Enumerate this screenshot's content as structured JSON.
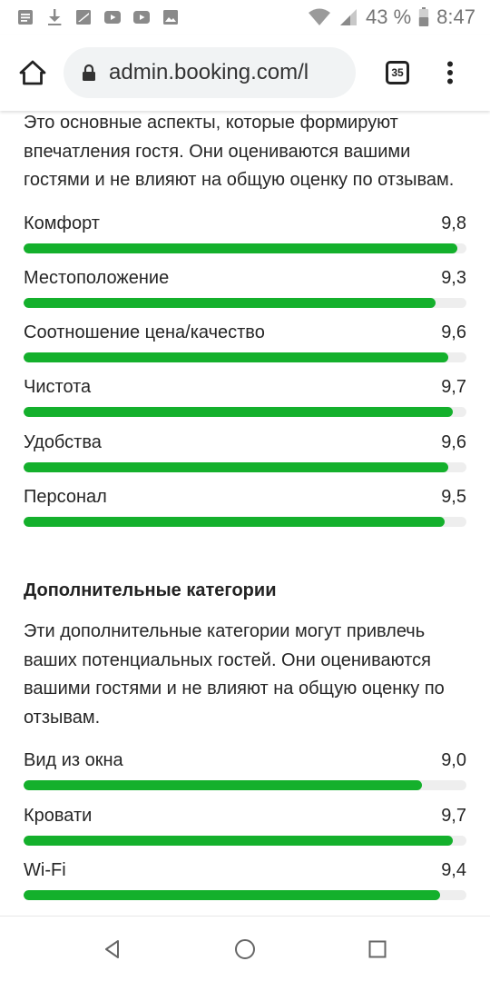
{
  "status_bar": {
    "battery_percent": "43 %",
    "time": "8:47",
    "icons": [
      "notes-icon",
      "download-icon",
      "image-broken-icon",
      "youtube-icon",
      "youtube-icon",
      "gallery-icon",
      "wifi-icon",
      "signal-icon",
      "battery-icon"
    ]
  },
  "browser": {
    "url": "admin.booking.com/l",
    "tabs_count": "35"
  },
  "main": {
    "intro_text": "Это основные аспекты, которые формируют впечатления гостя. Они оцениваются вашими гостями и не влияют на общую оценку по отзывам.",
    "ratings": [
      {
        "label": "Комфорт",
        "score_text": "9,8",
        "score": 9.8
      },
      {
        "label": "Местоположение",
        "score_text": "9,3",
        "score": 9.3
      },
      {
        "label": "Соотношение цена/качество",
        "score_text": "9,6",
        "score": 9.6
      },
      {
        "label": "Чистота",
        "score_text": "9,7",
        "score": 9.7
      },
      {
        "label": "Удобства",
        "score_text": "9,6",
        "score": 9.6
      },
      {
        "label": "Персонал",
        "score_text": "9,5",
        "score": 9.5
      }
    ],
    "extra_title": "Дополнительные категории",
    "extra_text": "Эти дополнительные категории могут привлечь ваших потенциальных гостей. Они оцениваются вашими гостями и не влияют на общую оценку по отзывам.",
    "extra_ratings": [
      {
        "label": "Вид из окна",
        "score_text": "9,0",
        "score": 9.0
      },
      {
        "label": "Кровати",
        "score_text": "9,7",
        "score": 9.7
      },
      {
        "label": "Wi-Fi",
        "score_text": "9,4",
        "score": 9.4
      }
    ],
    "max_score": 10
  },
  "colors": {
    "bar_fill": "#14b02c",
    "bar_track": "#eeeeee"
  }
}
